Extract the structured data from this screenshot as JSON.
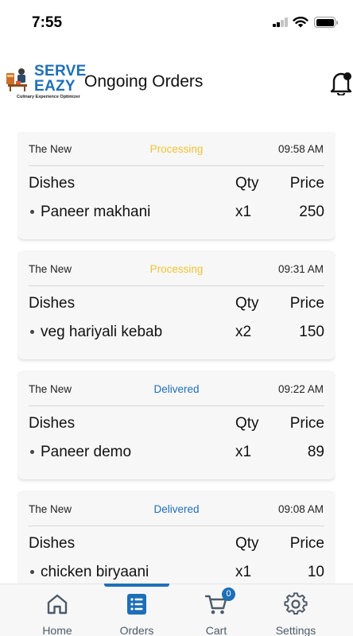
{
  "status_bar": {
    "time": "7:55"
  },
  "header": {
    "logo_line1": "SERVE",
    "logo_line2": "EAZY",
    "logo_tagline": "Culinary Experience Optimizer",
    "title": "Ongoing Orders"
  },
  "table_headers": {
    "dishes": "Dishes",
    "qty": "Qty",
    "price": "Price"
  },
  "colors": {
    "processing": "#f1c232",
    "delivered": "#1e6fb8",
    "accent": "#1e6fb8"
  },
  "orders": [
    {
      "restaurant": "The New",
      "status": "Processing",
      "time": "09:58 AM",
      "dish": "Paneer makhani",
      "qty": "x1",
      "price": "250"
    },
    {
      "restaurant": "The New",
      "status": "Processing",
      "time": "09:31 AM",
      "dish": "veg hariyali kebab",
      "qty": "x2",
      "price": "150"
    },
    {
      "restaurant": "The New",
      "status": "Delivered",
      "time": "09:22 AM",
      "dish": "Paneer demo",
      "qty": "x1",
      "price": "89"
    },
    {
      "restaurant": "The New",
      "status": "Delivered",
      "time": "09:08 AM",
      "dish": "chicken biryaani",
      "qty": "x1",
      "price": "10"
    }
  ],
  "nav": {
    "items": [
      {
        "label": "Home",
        "icon": "home-icon"
      },
      {
        "label": "Orders",
        "icon": "orders-list-icon"
      },
      {
        "label": "Cart",
        "icon": "cart-icon",
        "badge": "0"
      },
      {
        "label": "Settings",
        "icon": "gear-icon"
      }
    ],
    "active": "Orders"
  }
}
